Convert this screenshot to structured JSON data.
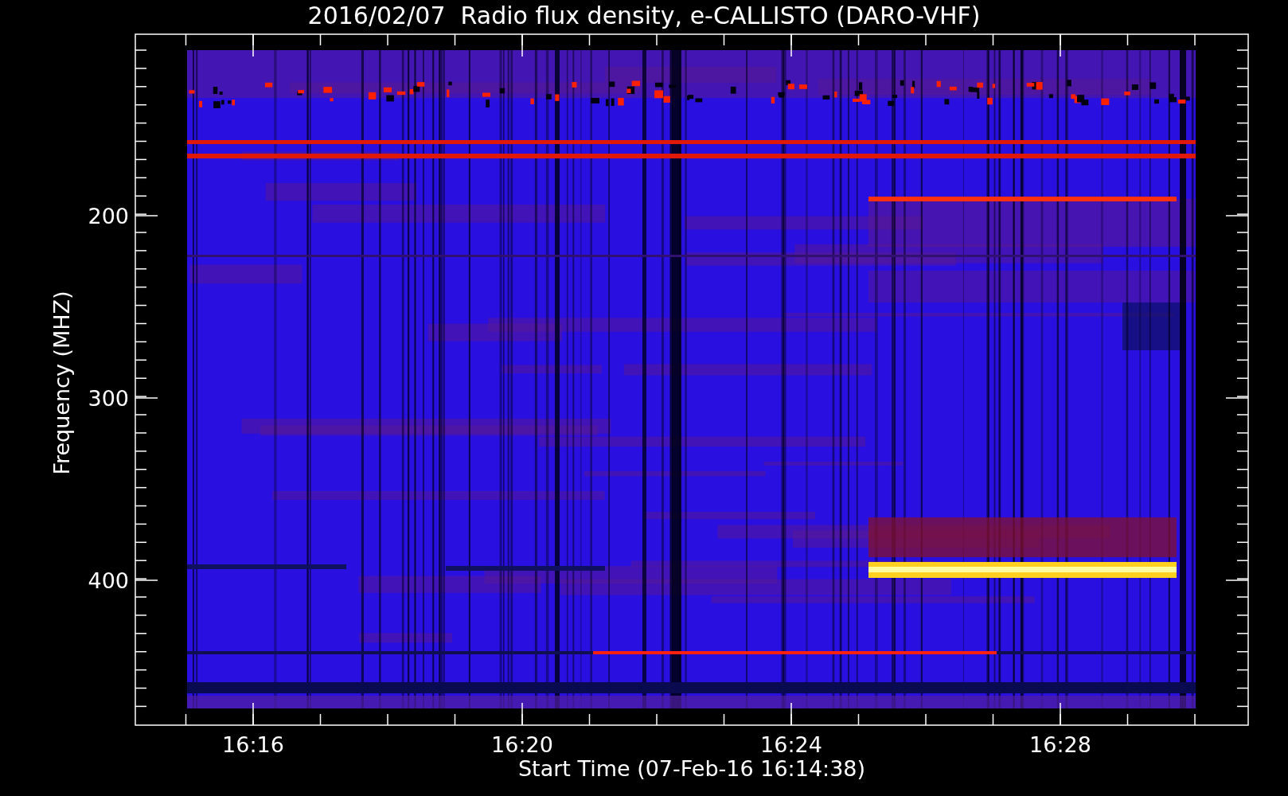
{
  "title": "2016/02/07  Radio flux density, e-CALLISTO (DARO-VHF)",
  "y_axis": {
    "label": "Frequency (MHZ)",
    "ticks": [
      "200",
      "300",
      "400"
    ]
  },
  "x_axis": {
    "label": "Start Time (07-Feb-16 16:14:38)",
    "ticks": [
      "16:16",
      "16:20",
      "16:24",
      "16:28"
    ]
  }
}
